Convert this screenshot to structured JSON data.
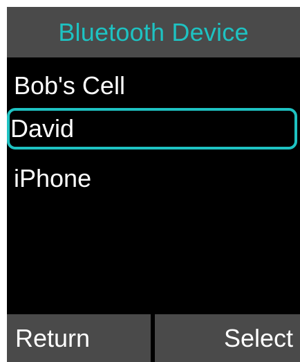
{
  "header": {
    "title": "Bluetooth Device"
  },
  "devices": [
    {
      "label": "Bob's Cell",
      "selected": false
    },
    {
      "label": "David",
      "selected": true
    },
    {
      "label": "iPhone",
      "selected": false
    }
  ],
  "softkeys": {
    "left_label": "Return",
    "right_label": "Select"
  },
  "colors": {
    "accent": "#1ec2c2",
    "screen_background": "#000000",
    "bar_background": "#4a4a4a",
    "text": "#ffffff"
  }
}
